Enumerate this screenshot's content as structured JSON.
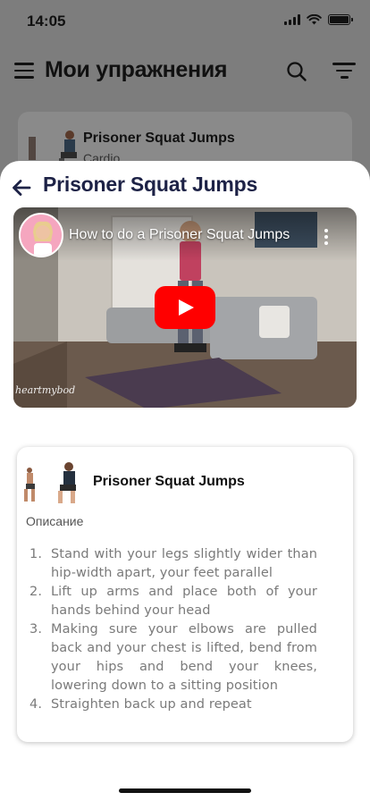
{
  "status_bar": {
    "time": "14:05"
  },
  "app_header": {
    "title": "Мои упражнения"
  },
  "background_list": {
    "items": [
      {
        "title": "Prisoner Squat Jumps",
        "category": "Cardio"
      }
    ]
  },
  "sheet": {
    "title": "Prisoner Squat Jumps",
    "video": {
      "title": "How to do a Prisoner Squat Jumps",
      "watermark": "heartmybod"
    },
    "detail": {
      "title": "Prisoner Squat Jumps",
      "description_label": "Описание",
      "steps": [
        {
          "num": "1.",
          "text": "Stand with your legs slightly wider than hip-width apart, your feet parallel"
        },
        {
          "num": "2.",
          "text": "Lift up arms and place both of your hands behind your head"
        },
        {
          "num": "3.",
          "text": "Making sure your elbows are pulled back and your chest is lifted, bend from your hips and bend your knees, lowering down to a sitting position"
        },
        {
          "num": "4.",
          "text": "Straighten back up and repeat"
        }
      ]
    }
  },
  "colors": {
    "accent": "#1d2246",
    "youtube_red": "#ff0000",
    "overlay": "#7d7d7d"
  },
  "icons": [
    "menu-icon",
    "search-icon",
    "filter-icon",
    "back-arrow-icon",
    "play-icon",
    "more-vertical-icon"
  ]
}
